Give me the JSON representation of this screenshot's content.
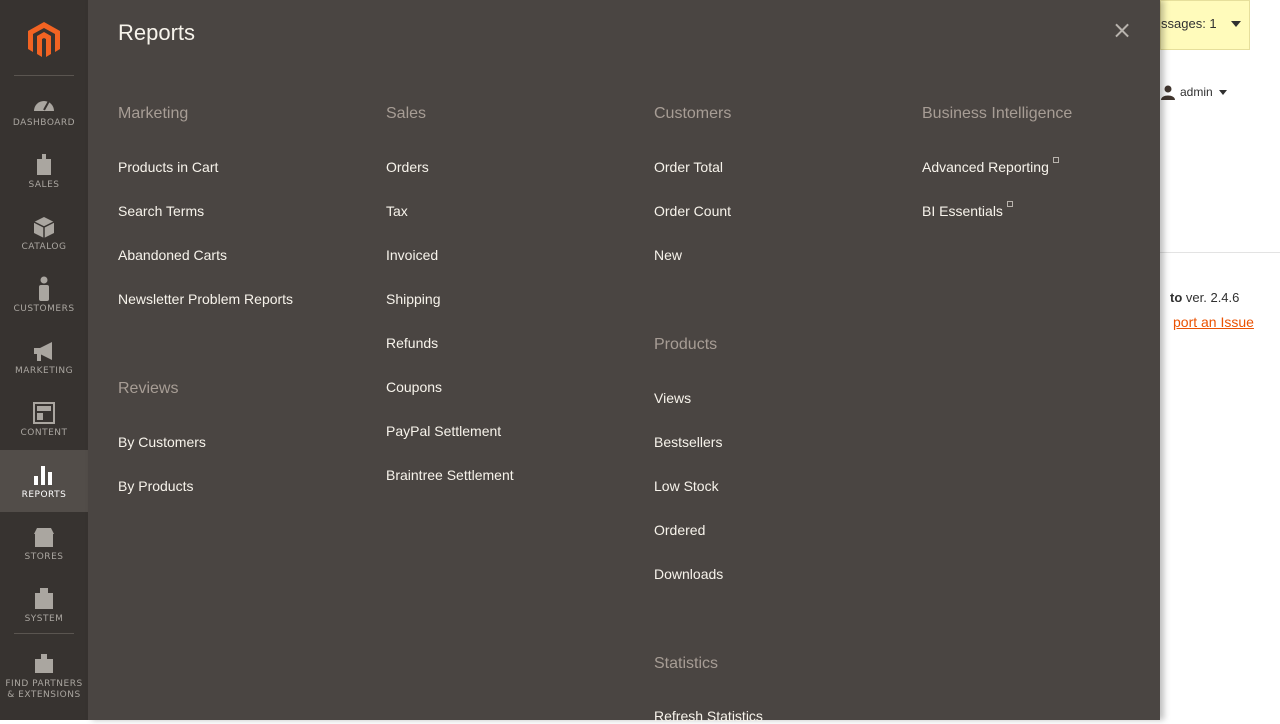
{
  "sidebar": {
    "items": [
      {
        "label": "Dashboard",
        "icon": "dashboard-icon"
      },
      {
        "label": "Sales",
        "icon": "dollar-icon"
      },
      {
        "label": "Catalog",
        "icon": "cube-icon"
      },
      {
        "label": "Customers",
        "icon": "person-icon"
      },
      {
        "label": "Marketing",
        "icon": "megaphone-icon"
      },
      {
        "label": "Content",
        "icon": "layout-icon"
      },
      {
        "label": "Reports",
        "icon": "bar-chart-icon",
        "active": true
      },
      {
        "label": "Stores",
        "icon": "store-icon"
      },
      {
        "label": "System",
        "icon": "gear-icon"
      },
      {
        "label": "Find Partners & Extensions",
        "icon": "extensions-icon"
      }
    ]
  },
  "flyout": {
    "title": "Reports",
    "close_label": "×",
    "marketing": {
      "title": "Marketing",
      "links": [
        "Products in Cart",
        "Search Terms",
        "Abandoned Carts",
        "Newsletter Problem Reports"
      ]
    },
    "reviews": {
      "title": "Reviews",
      "links": [
        "By Customers",
        "By Products"
      ]
    },
    "sales": {
      "title": "Sales",
      "links": [
        "Orders",
        "Tax",
        "Invoiced",
        "Shipping",
        "Refunds",
        "Coupons",
        "PayPal Settlement",
        "Braintree Settlement"
      ]
    },
    "customers": {
      "title": "Customers",
      "links": [
        "Order Total",
        "Order Count",
        "New"
      ]
    },
    "products": {
      "title": "Products",
      "links": [
        "Views",
        "Bestsellers",
        "Low Stock",
        "Ordered",
        "Downloads"
      ]
    },
    "statistics": {
      "title": "Statistics",
      "links": [
        "Refresh Statistics"
      ]
    },
    "business_intelligence": {
      "title": "Business Intelligence",
      "links": [
        "Advanced Reporting",
        "BI Essentials"
      ]
    }
  },
  "page": {
    "messages_text": "ssages: 1",
    "user_name": "admin",
    "version_brand": "to",
    "version_text": " ver. 2.4.6",
    "report_issue": "port an Issue"
  },
  "colors": {
    "sidebar_bg": "#373330",
    "flyout_bg": "#4a4542",
    "accent": "#eb5202",
    "logo": "#f26322"
  }
}
